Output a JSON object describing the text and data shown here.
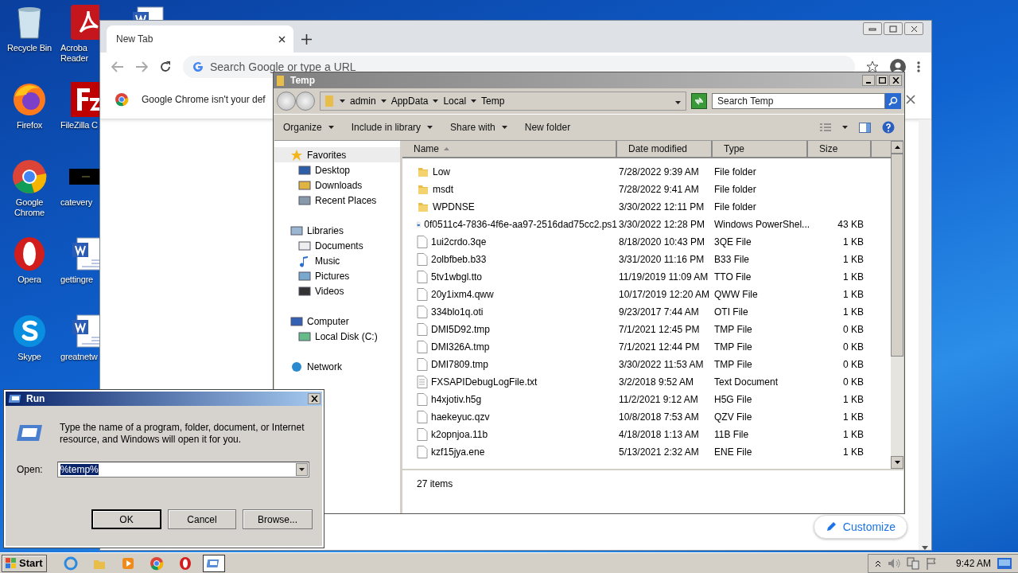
{
  "desktop_icons": [
    {
      "kind": "recycle",
      "label": "Recycle Bin"
    },
    {
      "kind": "pdf",
      "label": "Acroba\nReader"
    },
    {
      "kind": "firefox",
      "label": "Firefox"
    },
    {
      "kind": "filezilla",
      "label": "FileZilla C"
    },
    {
      "kind": "chrome",
      "label": "Google\nChrome"
    },
    {
      "kind": "thumb",
      "label": "catevery"
    },
    {
      "kind": "opera",
      "label": "Opera"
    },
    {
      "kind": "doc",
      "label": "gettingre"
    },
    {
      "kind": "skype",
      "label": "Skype"
    },
    {
      "kind": "doc",
      "label": "greatnetw"
    }
  ],
  "partly_hidden_icon": {
    "kind": "doc"
  },
  "chrome": {
    "tab_title": "New Tab",
    "omnibox": {
      "placeholder": "Search Google or type a URL"
    },
    "infobar_text": "Google Chrome isn't your def",
    "customize_label": "Customize"
  },
  "explorer": {
    "title": "Temp",
    "breadcrumb": [
      "admin",
      "AppData",
      "Local",
      "Temp"
    ],
    "search": {
      "placeholder": "Search Temp"
    },
    "toolbar": [
      {
        "label": "Organize",
        "menu": true
      },
      {
        "label": "Include in library",
        "menu": true
      },
      {
        "label": "Share with",
        "menu": true
      },
      {
        "label": "New folder",
        "menu": false
      }
    ],
    "nav": [
      {
        "label": "Favorites",
        "kind": "star",
        "selected": true,
        "children": [
          {
            "label": "Desktop",
            "kind": "desktop",
            "selected": false
          },
          {
            "label": "Downloads",
            "kind": "downloads",
            "selected": false
          },
          {
            "label": "Recent Places",
            "kind": "recent",
            "selected": false
          }
        ]
      },
      {
        "label": "Libraries",
        "kind": "library",
        "selected": false,
        "children": [
          {
            "label": "Documents",
            "kind": "documents",
            "selected": false
          },
          {
            "label": "Music",
            "kind": "music",
            "selected": false
          },
          {
            "label": "Pictures",
            "kind": "pictures",
            "selected": false
          },
          {
            "label": "Videos",
            "kind": "videos",
            "selected": false
          }
        ]
      },
      {
        "label": "Computer",
        "kind": "computer",
        "selected": false,
        "children": [
          {
            "label": "Local Disk (C:)",
            "kind": "disk",
            "selected": false
          }
        ]
      },
      {
        "label": "Network",
        "kind": "network",
        "selected": false
      }
    ],
    "columns": [
      {
        "label": "Name",
        "sorted": true
      },
      {
        "label": "Date modified",
        "sorted": false
      },
      {
        "label": "Type",
        "sorted": false
      },
      {
        "label": "Size",
        "sorted": false
      }
    ],
    "rows": [
      {
        "kind": "folder",
        "name": "Low",
        "date": "7/28/2022 9:39 AM",
        "type": "File folder"
      },
      {
        "kind": "folder",
        "name": "msdt",
        "date": "7/28/2022 9:41 AM",
        "type": "File folder"
      },
      {
        "kind": "folder",
        "name": "WPDNSE",
        "date": "3/30/2022 12:11 PM",
        "type": "File folder"
      },
      {
        "kind": "script",
        "name": "0f0511c4-7836-4f6e-aa97-2516dad75cc2.ps1",
        "date": "3/30/2022 12:28 PM",
        "type": "Windows PowerShel...",
        "size": "43 KB"
      },
      {
        "kind": "file",
        "name": "1ui2crdo.3qe",
        "date": "8/18/2020 10:43 PM",
        "type": "3QE File",
        "size": "1 KB"
      },
      {
        "kind": "file",
        "name": "2olbfbeb.b33",
        "date": "3/31/2020 11:16 PM",
        "type": "B33 File",
        "size": "1 KB"
      },
      {
        "kind": "file",
        "name": "5tv1wbgl.tto",
        "date": "11/19/2019 11:09 AM",
        "type": "TTO File",
        "size": "1 KB"
      },
      {
        "kind": "file",
        "name": "20y1ixm4.qww",
        "date": "10/17/2019 12:20 AM",
        "type": "QWW File",
        "size": "1 KB"
      },
      {
        "kind": "file",
        "name": "334blo1q.oti",
        "date": "9/23/2017 7:44 AM",
        "type": "OTI File",
        "size": "1 KB"
      },
      {
        "kind": "file",
        "name": "DMI5D92.tmp",
        "date": "7/1/2021 12:45 PM",
        "type": "TMP File",
        "size": "0 KB"
      },
      {
        "kind": "file",
        "name": "DMI326A.tmp",
        "date": "7/1/2021 12:44 PM",
        "type": "TMP File",
        "size": "0 KB"
      },
      {
        "kind": "file",
        "name": "DMI7809.tmp",
        "date": "3/30/2022 11:53 AM",
        "type": "TMP File",
        "size": "0 KB"
      },
      {
        "kind": "text",
        "name": "FXSAPIDebugLogFile.txt",
        "date": "3/2/2018 9:52 AM",
        "type": "Text Document",
        "size": "0 KB"
      },
      {
        "kind": "file",
        "name": "h4xjotiv.h5g",
        "date": "11/2/2021 9:12 AM",
        "type": "H5G File",
        "size": "1 KB"
      },
      {
        "kind": "file",
        "name": "haekeyuc.qzv",
        "date": "10/8/2018 7:53 AM",
        "type": "QZV File",
        "size": "1 KB"
      },
      {
        "kind": "file",
        "name": "k2opnjoa.11b",
        "date": "4/18/2018 1:13 AM",
        "type": "11B File",
        "size": "1 KB"
      },
      {
        "kind": "file",
        "name": "kzf15jya.ene",
        "date": "5/13/2021 2:32 AM",
        "type": "ENE File",
        "size": "1 KB"
      }
    ],
    "status": "27 items"
  },
  "run": {
    "title": "Run",
    "prompt": "Type the name of a program, folder, document, or Internet resource, and Windows will open it for you.",
    "open_label": "Open:",
    "value": "%temp%",
    "buttons": [
      {
        "label": "OK",
        "default": true
      },
      {
        "label": "Cancel",
        "default": false
      },
      {
        "label": "Browse...",
        "default": false
      }
    ]
  },
  "taskbar": {
    "start": "Start",
    "apps": [
      {
        "kind": "ie",
        "selected": false
      },
      {
        "kind": "explorer",
        "selected": false
      },
      {
        "kind": "media",
        "selected": false
      },
      {
        "kind": "chrome",
        "selected": false
      },
      {
        "kind": "opera",
        "selected": false
      },
      {
        "kind": "run",
        "selected": true
      }
    ],
    "clock": "9:42 AM"
  }
}
